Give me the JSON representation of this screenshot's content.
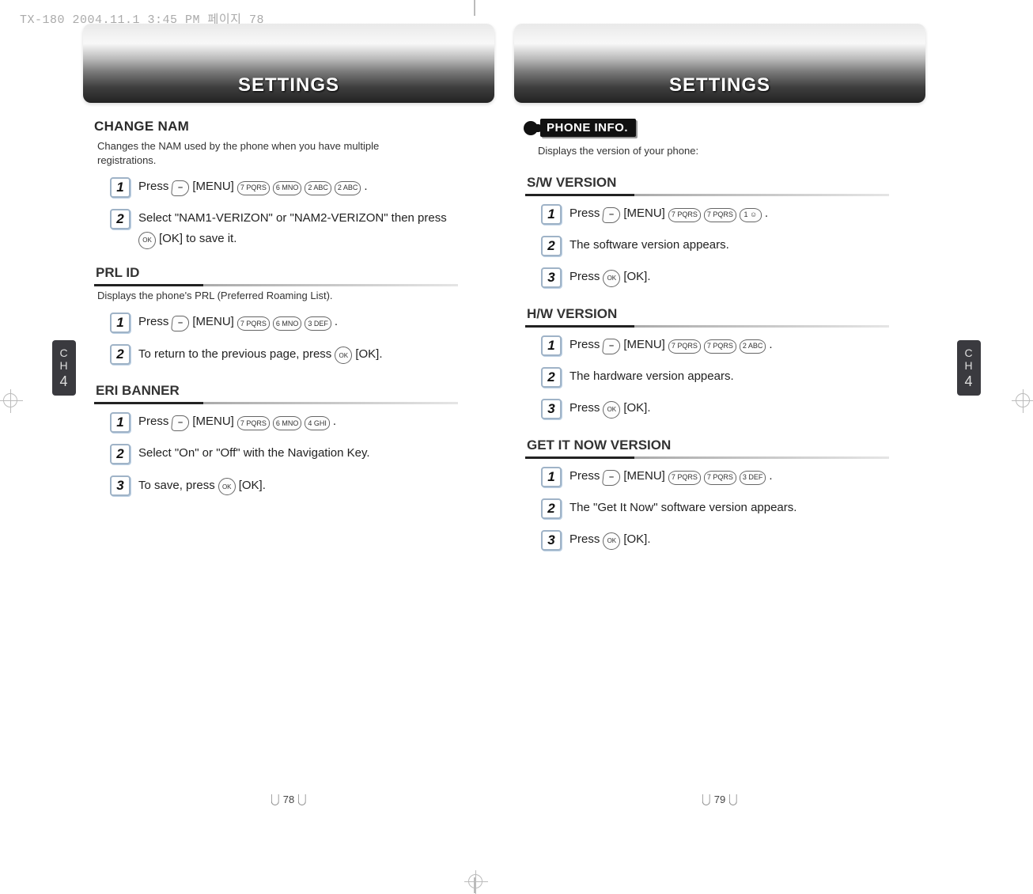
{
  "doc_header": "TX-180  2004.11.1 3:45 PM 페이지 78",
  "banner_title": "SETTINGS",
  "side_tab": {
    "line1": "C",
    "line2": "H",
    "num": "4"
  },
  "page_numbers": {
    "left": "78",
    "right": "79"
  },
  "keys": {
    "menu": "[MENU]",
    "ok": "[OK]",
    "soft": "–",
    "ok_key": "OK",
    "k1": "1 ☺",
    "k2": "2 ABC",
    "k3": "3 DEF",
    "k4": "4 GHI",
    "k6": "6 MNO",
    "k7": "7 PQRS"
  },
  "left_page": {
    "change_nam": {
      "title": "CHANGE NAM",
      "desc": "Changes the NAM used by the phone when you have multiple registrations.",
      "step1_a": "Press",
      "step1_dot": ".",
      "step2": "Select \"NAM1-VERIZON\" or \"NAM2-VERIZON\" then press",
      "step2_b": "[OK] to save it."
    },
    "prl": {
      "title": "PRL ID",
      "desc": "Displays the phone's PRL (Preferred Roaming List).",
      "step1_a": "Press",
      "step1_dot": ".",
      "step2_a": "To return to the previous page, press",
      "step2_b": "[OK]."
    },
    "eri": {
      "title": "ERI BANNER",
      "step1_a": "Press",
      "step1_dot": ".",
      "step2": "Select \"On\" or \"Off\" with the Navigation Key.",
      "step3_a": "To save, press",
      "step3_b": "[OK]."
    }
  },
  "right_page": {
    "pill": "PHONE INFO.",
    "desc": "Displays the version of your phone:",
    "sw": {
      "title": "S/W VERSION",
      "s1": "Press",
      "s1d": ".",
      "s2": "The software version appears.",
      "s3a": "Press",
      "s3b": "[OK]."
    },
    "hw": {
      "title": "H/W VERSION",
      "s1": "Press",
      "s1d": ".",
      "s2": "The hardware version appears.",
      "s3a": "Press",
      "s3b": "[OK]."
    },
    "gin": {
      "title": "GET IT NOW VERSION",
      "s1": "Press",
      "s1d": ".",
      "s2": "The \"Get It Now\" software version appears.",
      "s3a": "Press",
      "s3b": "[OK]."
    }
  }
}
